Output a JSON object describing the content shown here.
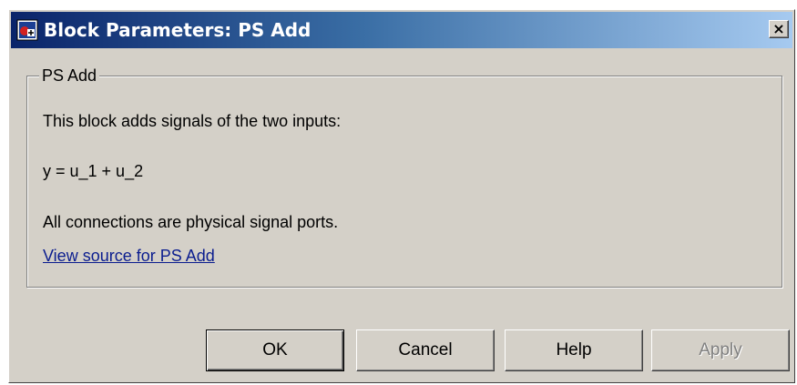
{
  "window": {
    "title": "Block Parameters: PS Add",
    "close_label": "×"
  },
  "group": {
    "title": "PS Add",
    "description": "This block adds signals of the two inputs:",
    "equation": "y = u_1 + u_2",
    "note": "All connections are physical signal ports.",
    "source_link": "View source for PS Add"
  },
  "buttons": {
    "ok": "OK",
    "cancel": "Cancel",
    "help": "Help",
    "apply": "Apply"
  },
  "colors": {
    "titlebar_start": "#0a246a",
    "titlebar_end": "#a6caf0",
    "dialog_bg": "#d4d0c8",
    "link": "#0b1d8f"
  },
  "icons": {
    "app": "simulink-block-icon",
    "close": "close-icon"
  }
}
